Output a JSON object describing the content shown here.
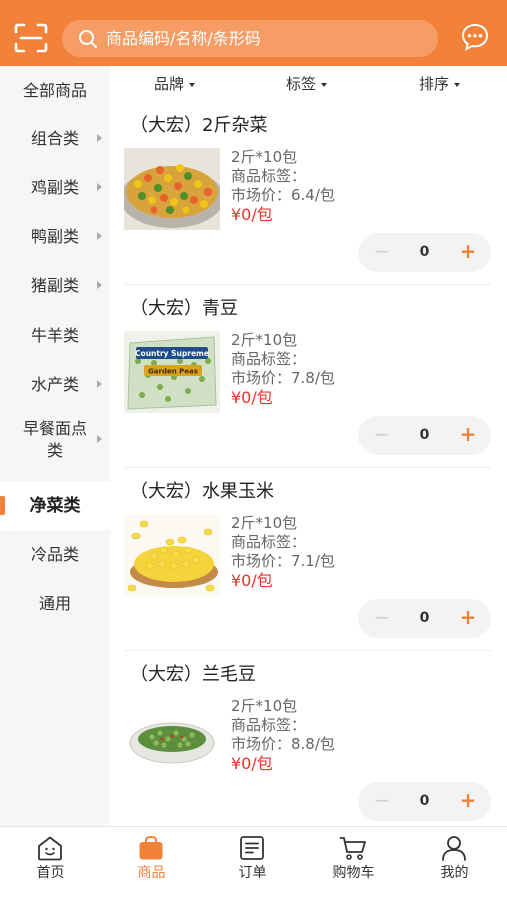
{
  "header": {
    "search_placeholder": "商品编码/名称/条形码",
    "scan_icon": "scan-icon",
    "message_icon": "message-icon"
  },
  "sidebar": {
    "items": [
      {
        "label": "全部商品",
        "has_arrow": false,
        "active": false
      },
      {
        "label": "组合类",
        "has_arrow": true,
        "active": false
      },
      {
        "label": "鸡副类",
        "has_arrow": true,
        "active": false
      },
      {
        "label": "鸭副类",
        "has_arrow": true,
        "active": false
      },
      {
        "label": "猪副类",
        "has_arrow": true,
        "active": false
      },
      {
        "label": "牛羊类",
        "has_arrow": false,
        "active": false
      },
      {
        "label": "水产类",
        "has_arrow": true,
        "active": false
      },
      {
        "label": "早餐面点类",
        "has_arrow": true,
        "active": false
      },
      {
        "label": "净菜类",
        "has_arrow": false,
        "active": true
      },
      {
        "label": "冷品类",
        "has_arrow": false,
        "active": false
      },
      {
        "label": "通用",
        "has_arrow": false,
        "active": false
      }
    ]
  },
  "filters": {
    "brand": "品牌",
    "tag": "标签",
    "sort": "排序"
  },
  "products": [
    {
      "name": "（大宏）2斤杂菜",
      "spec": "2斤*10包",
      "tag": "商品标签：",
      "market": "市场价：6.4/包",
      "price": "¥0/包",
      "qty": "0",
      "image": "mixed-vegetables"
    },
    {
      "name": "（大宏）青豆",
      "spec": "2斤*10包",
      "tag": "商品标签：",
      "market": "市场价：7.8/包",
      "price": "¥0/包",
      "qty": "0",
      "image": "green-peas-bag",
      "image_text": "Country Supreme / Garden Peas"
    },
    {
      "name": "（大宏）水果玉米",
      "spec": "2斤*10包",
      "tag": "商品标签：",
      "market": "市场价：7.1/包",
      "price": "¥0/包",
      "qty": "0",
      "image": "sweet-corn"
    },
    {
      "name": "（大宏）兰毛豆",
      "spec": "2斤*10包",
      "tag": "商品标签：",
      "market": "市场价：8.8/包",
      "price": "¥0/包",
      "qty": "0",
      "image": "edamame-plate"
    }
  ],
  "stepper": {
    "minus": "−",
    "plus": "+"
  },
  "tabbar": {
    "items": [
      {
        "label": "首页",
        "icon": "home-icon",
        "active": false
      },
      {
        "label": "商品",
        "icon": "bag-icon",
        "active": true
      },
      {
        "label": "订单",
        "icon": "order-icon",
        "active": false
      },
      {
        "label": "购物车",
        "icon": "cart-icon",
        "active": false
      },
      {
        "label": "我的",
        "icon": "user-icon",
        "active": false
      }
    ]
  },
  "colors": {
    "accent": "#f2823a",
    "price": "#e8352b",
    "sidebar_bg": "#f6f6f6"
  }
}
